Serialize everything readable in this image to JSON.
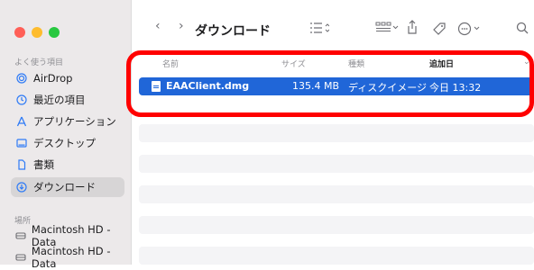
{
  "window": {
    "title": "ダウンロード"
  },
  "traffic_lights": {
    "close": "#ff5f57",
    "minimize": "#febc2e",
    "zoom": "#28c840"
  },
  "sidebar": {
    "favorites_title": "よく使う項目",
    "locations_title": "場所",
    "favorites": [
      {
        "label": "AirDrop",
        "icon": "airdrop-icon"
      },
      {
        "label": "最近の項目",
        "icon": "clock-icon"
      },
      {
        "label": "アプリケーション",
        "icon": "applications-icon"
      },
      {
        "label": "デスクトップ",
        "icon": "desktop-icon"
      },
      {
        "label": "書類",
        "icon": "document-icon"
      },
      {
        "label": "ダウンロード",
        "icon": "download-icon"
      }
    ],
    "locations": [
      {
        "label": "Macintosh HD - Data",
        "icon": "disk-icon"
      },
      {
        "label": "Macintosh HD - Data",
        "icon": "disk-icon"
      }
    ]
  },
  "table": {
    "headers": {
      "name": "名前",
      "size": "サイズ",
      "kind": "種類",
      "date_added": "追加日"
    },
    "rows": [
      {
        "name": "EAAClient.dmg",
        "size": "135.4 MB",
        "kind": "ディスクイメージ",
        "date_added": "今日 13:32"
      }
    ]
  },
  "colors": {
    "selection": "#2066d8",
    "highlight_border": "#ff0000"
  }
}
